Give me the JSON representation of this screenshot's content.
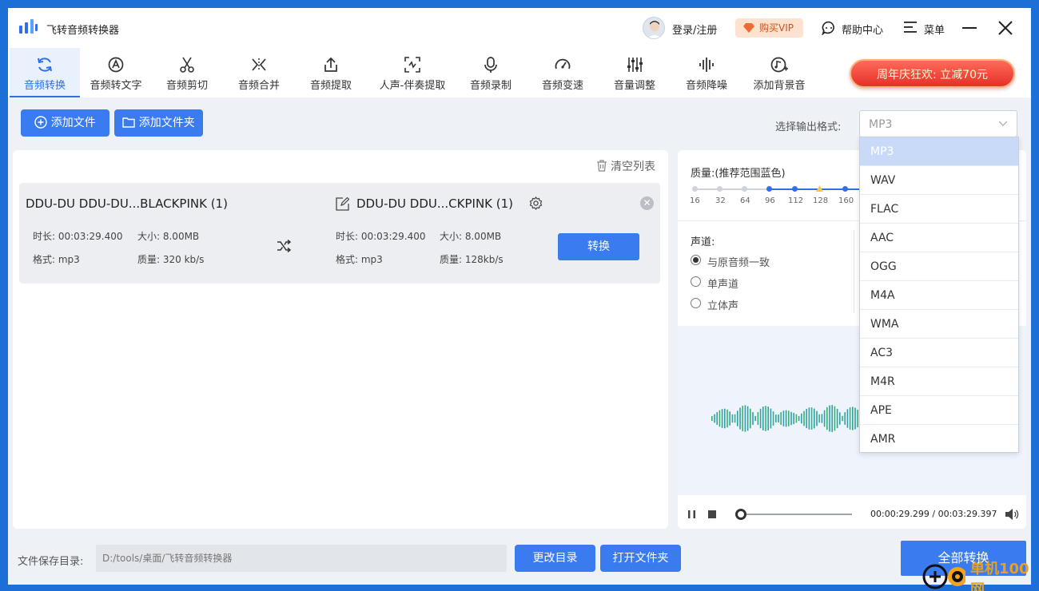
{
  "app": {
    "title": "飞转音频转换器"
  },
  "header": {
    "login": "登录/注册",
    "vip": "购买VIP",
    "help": "帮助中心",
    "menu": "菜单"
  },
  "tabs": [
    {
      "label": "音频转换",
      "icon": "convert-icon",
      "active": true
    },
    {
      "label": "音频转文字",
      "icon": "audio-to-text-icon"
    },
    {
      "label": "音频剪切",
      "icon": "scissors-icon"
    },
    {
      "label": "音频合并",
      "icon": "merge-icon"
    },
    {
      "label": "音频提取",
      "icon": "extract-icon"
    },
    {
      "label": "人声-伴奏提取",
      "icon": "vocal-separate-icon"
    },
    {
      "label": "音频录制",
      "icon": "microphone-icon"
    },
    {
      "label": "音频变速",
      "icon": "speedometer-icon"
    },
    {
      "label": "音量调整",
      "icon": "sliders-icon"
    },
    {
      "label": "音频降噪",
      "icon": "noise-reduction-icon"
    },
    {
      "label": "添加背景音",
      "icon": "add-music-icon"
    }
  ],
  "promo": "周年庆狂欢: 立减70元",
  "actions": {
    "add_file": "添加文件",
    "add_folder": "添加文件夹"
  },
  "output_format": {
    "label": "选择输出格式:",
    "value": "MP3"
  },
  "file_list": {
    "clear": "清空列表",
    "items": [
      {
        "source_name": "DDU-DU DDU-DU...BLACKPINK (1)",
        "target_name": "DDU-DU DDU...CKPINK (1)",
        "src_duration": "时长: 00:03:29.400",
        "src_size": "大小: 8.00MB",
        "src_format": "格式: mp3",
        "src_quality": "质量: 320 kb/s",
        "dst_duration": "时长: 00:03:29.400",
        "dst_size": "大小: 8.00MB",
        "dst_format": "格式: mp3",
        "dst_quality": "质量: 128kb/s",
        "convert": "转换"
      }
    ]
  },
  "settings": {
    "quality_label": "质量:(推荐范围蓝色)",
    "ticks": [
      "16",
      "32",
      "64",
      "96",
      "112",
      "128",
      "160"
    ],
    "channel_label": "声道:",
    "channels": [
      "与原音频一致",
      "单声道",
      "立体声"
    ]
  },
  "player": {
    "time": "00:00:29.299 / 00:03:29.397",
    "progress": 0.05
  },
  "format_options": [
    "MP3",
    "WAV",
    "FLAC",
    "AAC",
    "OGG",
    "M4A",
    "WMA",
    "AC3",
    "M4R",
    "APE",
    "AMR"
  ],
  "bottom": {
    "save_label": "文件保存目录:",
    "path": "D:/tools/桌面/飞转音频转换器",
    "change_dir": "更改目录",
    "open_folder": "打开文件夹",
    "convert_all": "全部转换"
  },
  "watermark": "单机100网"
}
